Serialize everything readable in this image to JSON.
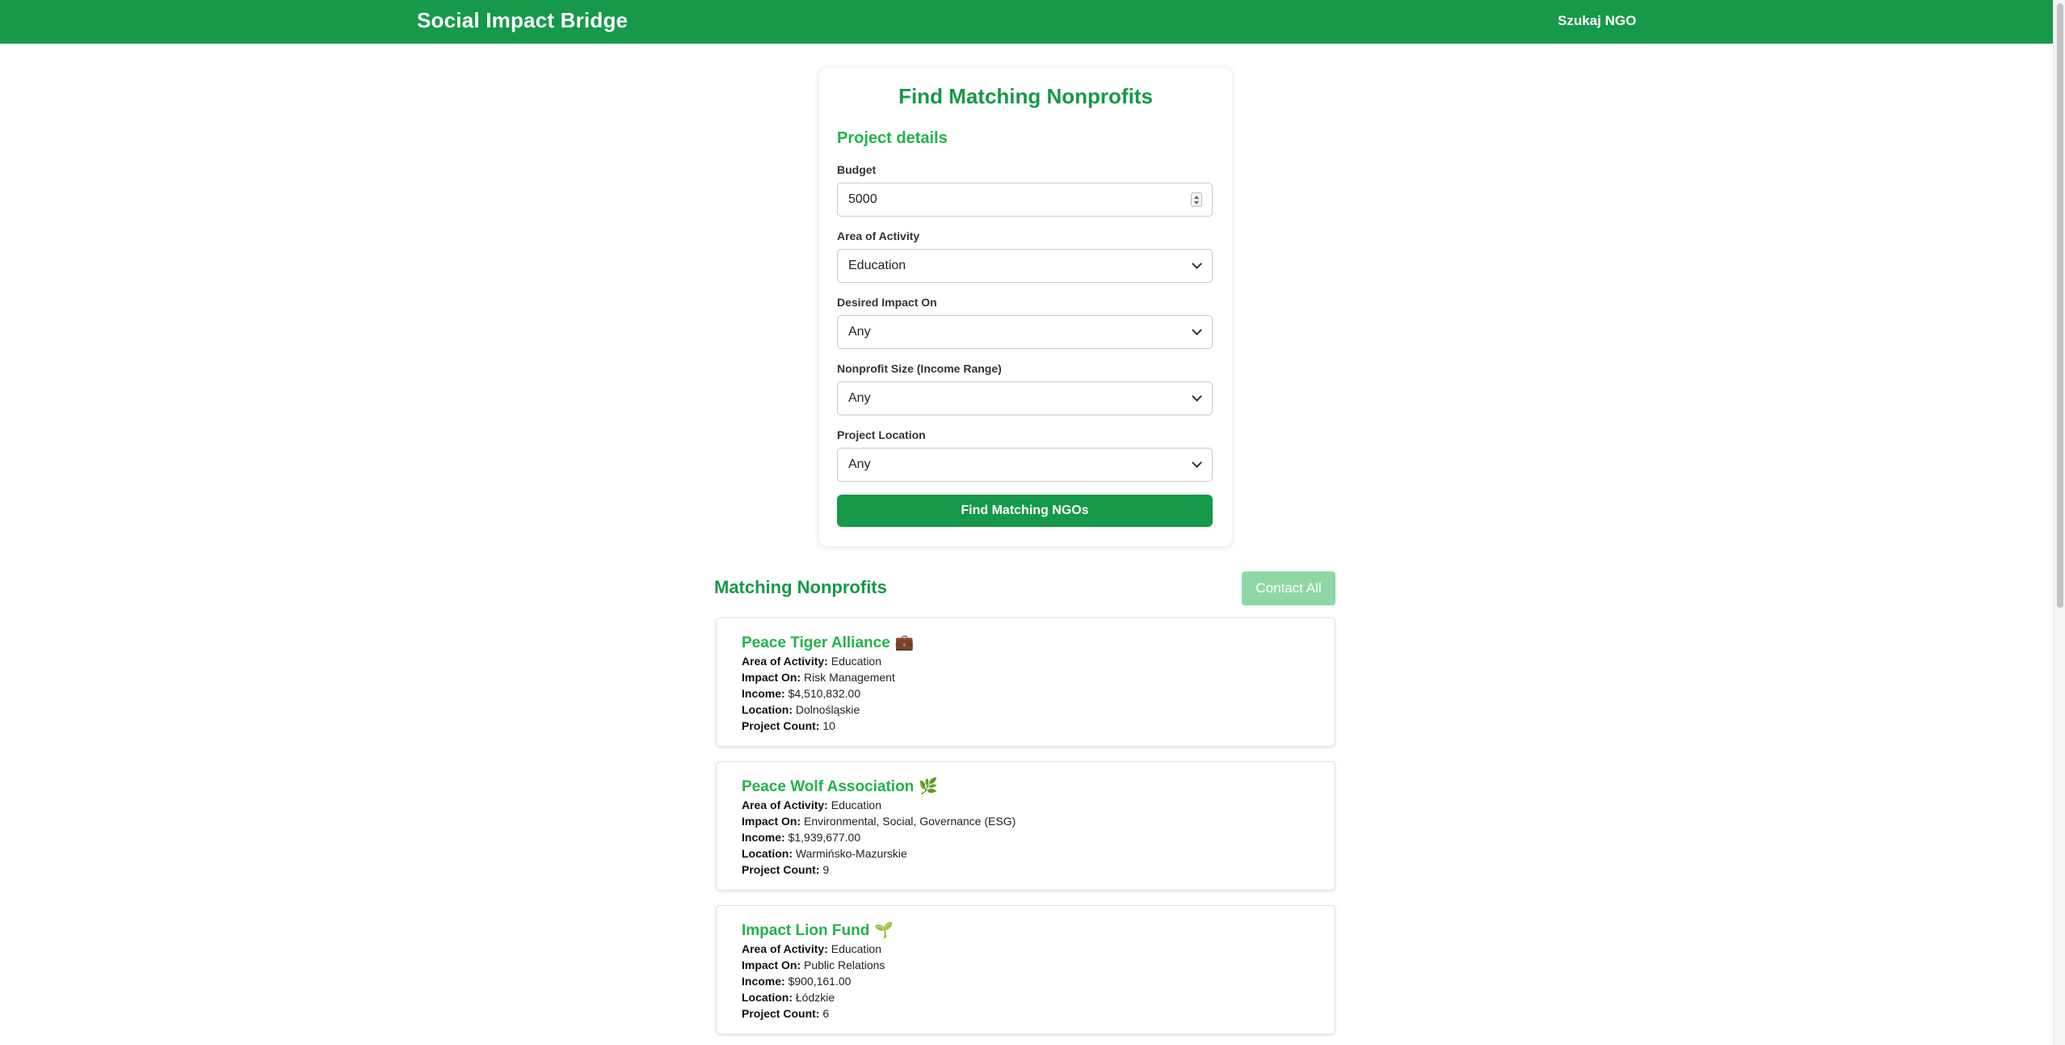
{
  "header": {
    "brand": "Social Impact Bridge",
    "nav_link": "Szukaj NGO"
  },
  "form": {
    "title": "Find Matching Nonprofits",
    "section_title": "Project details",
    "budget": {
      "label": "Budget",
      "value": "5000"
    },
    "area": {
      "label": "Area of Activity",
      "value": "Education"
    },
    "impact": {
      "label": "Desired Impact On",
      "value": "Any"
    },
    "size": {
      "label": "Nonprofit Size (Income Range)",
      "value": "Any"
    },
    "location": {
      "label": "Project Location",
      "value": "Any"
    },
    "submit_label": "Find Matching NGOs"
  },
  "results": {
    "title": "Matching Nonprofits",
    "contact_all_label": "Contact All",
    "labels": {
      "area": "Area of Activity:",
      "impact": "Impact On:",
      "income": "Income:",
      "location": "Location:",
      "count": "Project Count:"
    },
    "items": [
      {
        "name": "Peace Tiger Alliance",
        "emoji": "💼",
        "area": "Education",
        "impact": "Risk Management",
        "income": "$4,510,832.00",
        "location": "Dolnośląskie",
        "count": "10"
      },
      {
        "name": "Peace Wolf Association",
        "emoji": "🌿",
        "area": "Education",
        "impact": "Environmental, Social, Governance (ESG)",
        "income": "$1,939,677.00",
        "location": "Warmińsko-Mazurskie",
        "count": "9"
      },
      {
        "name": "Impact Lion Fund",
        "emoji": "🌱",
        "area": "Education",
        "impact": "Public Relations",
        "income": "$900,161.00",
        "location": "Łódzkie",
        "count": "6"
      }
    ]
  },
  "colors": {
    "brand_green": "#16994a",
    "accent_green": "#22b24c",
    "disabled_green": "#8fd8a5"
  }
}
